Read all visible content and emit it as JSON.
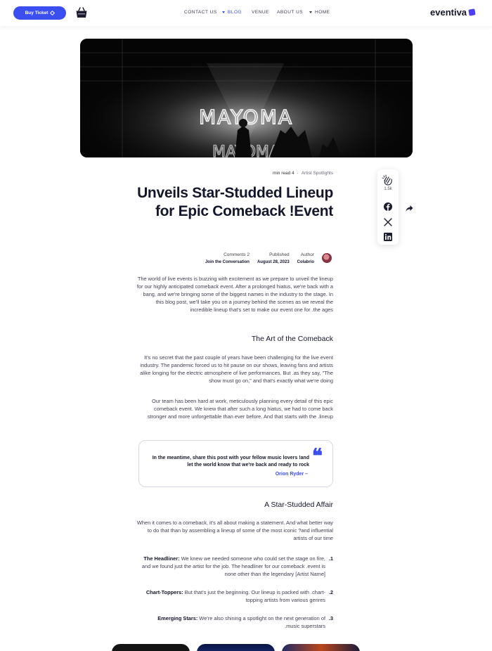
{
  "header": {
    "buy_ticket": "Buy Ticket",
    "nav": [
      "CONTACT US",
      "BLOG",
      "VENUE",
      "ABOUT US",
      "HOME"
    ],
    "logo": "eventiva",
    "cart_icon": "shopping-basket-icon"
  },
  "hero": {
    "image_alt": "MAYOMA"
  },
  "post": {
    "read_time": "min read 4",
    "separator": "·",
    "category": "Artist Spotlights",
    "title": "Unveils Star-Studded Lineup for Epic Comeback !Event",
    "comments": "Comments 2",
    "comments_sub": "Join the Conversation",
    "published_label": "Published",
    "published_date": "August 28, 2023",
    "author_label": "Author",
    "author_name": "Colabrio",
    "intro": "The world of live events is buzzing with excitement as we prepare to unveil the lineup for our highly anticipated comeback event. After a prolonged hiatus, we're back with a bang, and we're bringing some of the biggest names in the industry to the stage. In this blog post, we'll take you on a journey behind the scenes as we reveal the incredible lineup that's set to make our event one for .the ages",
    "h2_1": "The Art of the Comeback",
    "p2": "It's no secret that the past couple of years have been challenging for the live event industry. The pandemic forced us to hit pause on our shows, leaving fans and artists alike longing for the electric atmosphere of live performances. But .as they say, \"The show must go on,\" and that's exactly what we're doing",
    "p3": "Our team has been hard at work, meticulously planning every detail of this epic comeback event. We knew that after such a long hiatus, we had to come back stronger and more unforgettable than ever before. And that starts with the .lineup",
    "quote": "In the meantime, share this post with your fellow music lovers !and let the world know that we're back and ready to rock",
    "quote_author": "Orion Ryder –",
    "h2_2": "A Star-Studded Affair",
    "p4": "When it comes to a comeback, it's all about making a statement. And what better way to do that than by assembling a lineup of some of the most iconic ?and influential artists of our time",
    "list": [
      {
        "num": ".1",
        "bold": "The Headliner:",
        "text": "We knew we needed someone who could set the stage on fire, and we found just the artist for the job. The headliner for our comeback .event is none other than the legendary [Artist Name]"
      },
      {
        "num": ".2",
        "bold": "Chart-Toppers:",
        "text": "But that's just the beginning. Our lineup is packed with .chart-topping artists from various genres"
      },
      {
        "num": ".3",
        "bold": "Emerging Stars:",
        "text": "We're also shining a spotlight on the next generation of .music superstars"
      }
    ]
  },
  "share": {
    "claps": "1.5k",
    "icons": [
      "clap-icon",
      "facebook-icon",
      "x-icon",
      "linkedin-icon",
      "share-icon"
    ]
  },
  "colors": {
    "accent": "#3b4ef0",
    "text": "#14162b"
  }
}
